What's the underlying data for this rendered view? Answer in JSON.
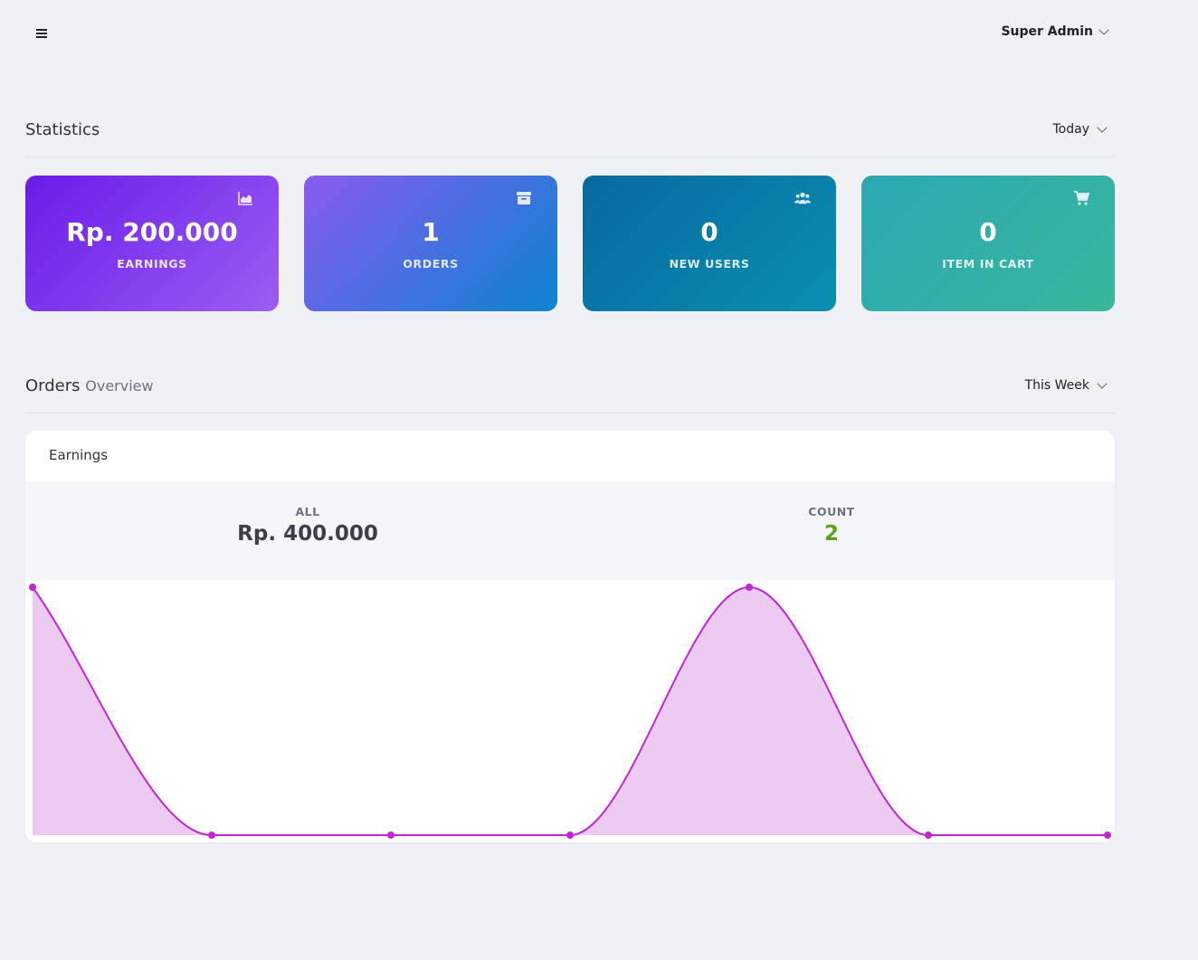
{
  "header": {
    "menu_icon": "hamburger-icon",
    "user_label": "Super Admin"
  },
  "statistics": {
    "title": "Statistics",
    "filter": "Today",
    "cards": [
      {
        "value": "Rp. 200.000",
        "label": "EARNINGS",
        "icon": "area-chart-icon",
        "gradient": [
          "#6a1be8",
          "#9a5ef2"
        ]
      },
      {
        "value": "1",
        "label": "ORDERS",
        "icon": "archive-box-icon",
        "gradient": [
          "#8a5af0",
          "#0a84d0"
        ]
      },
      {
        "value": "0",
        "label": "NEW USERS",
        "icon": "users-icon",
        "gradient": [
          "#07699e",
          "#0a8fb2"
        ]
      },
      {
        "value": "0",
        "label": "ITEM IN CART",
        "icon": "shopping-cart-icon",
        "gradient": [
          "#2ba8b4",
          "#38b79a"
        ]
      }
    ]
  },
  "orders": {
    "title": "Orders",
    "subtitle": "Overview",
    "filter": "This Week",
    "panel_title": "Earnings",
    "all_label": "ALL",
    "all_value": "Rp. 400.000",
    "count_label": "COUNT",
    "count_value": "2",
    "count_color": "#5ba11b"
  },
  "chart_data": {
    "type": "area",
    "x": [
      1,
      2,
      3,
      4,
      5,
      6,
      7
    ],
    "series": [
      {
        "values": [
          200000,
          0,
          0,
          0,
          200000,
          0,
          0
        ]
      }
    ],
    "ylim": [
      0,
      200000
    ],
    "line_color": "#c026d3",
    "fill_color": "#eccaf2",
    "grid": false
  }
}
